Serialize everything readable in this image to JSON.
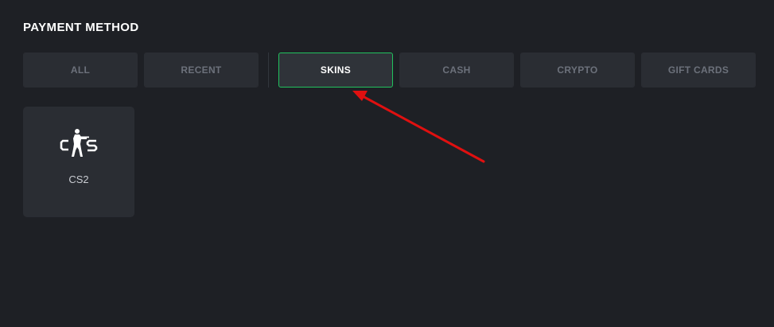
{
  "header": {
    "title": "PAYMENT METHOD"
  },
  "tabs": [
    {
      "label": "ALL",
      "active": false
    },
    {
      "label": "RECENT",
      "active": false
    },
    {
      "label": "SKINS",
      "active": true
    },
    {
      "label": "CASH",
      "active": false
    },
    {
      "label": "CRYPTO",
      "active": false
    },
    {
      "label": "GIFT CARDS",
      "active": false
    }
  ],
  "methods": [
    {
      "label": "CS2",
      "icon": "cs2-logo-icon"
    }
  ],
  "colors": {
    "background": "#1e2025",
    "tab_background": "#2a2d33",
    "active_border": "#21c25e",
    "annotation_arrow": "#e01010"
  }
}
